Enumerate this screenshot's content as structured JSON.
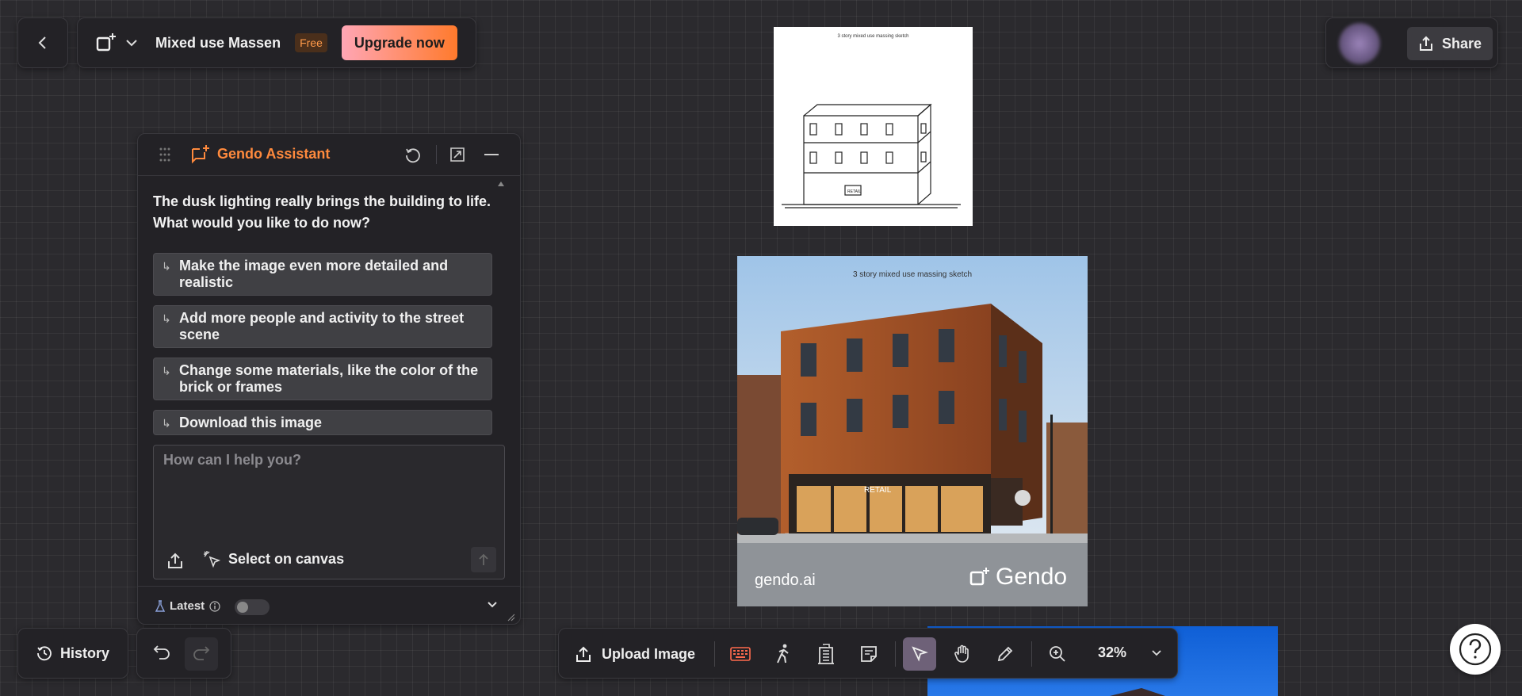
{
  "header": {
    "project_title": "Mixed use Massen",
    "plan_badge": "Free",
    "upgrade_label": "Upgrade now",
    "share_label": "Share"
  },
  "assistant": {
    "title": "Gendo Assistant",
    "message": "The dusk lighting really brings the building to life. What would you like to do now?",
    "suggestions": [
      "Make the image even more detailed and realistic",
      "Add more people and activity to the street scene",
      "Change some materials, like the color of the brick or frames",
      "Download this image"
    ],
    "input_placeholder": "How can I help you?",
    "select_on_canvas_label": "Select on canvas",
    "latest_label": "Latest",
    "latest_toggle_on": false
  },
  "canvas": {
    "sketch_caption": "3 story mixed use massing sketch",
    "render_caption": "3 story mixed use massing sketch",
    "render_sign": "RETAIL",
    "sketch_sign": "RETAIL",
    "watermark_left": "gendo.ai",
    "watermark_brand": "Gendo"
  },
  "bottom": {
    "history_label": "History",
    "upload_image_label": "Upload Image",
    "zoom_level": "32%"
  },
  "colors": {
    "accent": "#ff8a3d",
    "upgrade_gradient_start": "#ffa6b5",
    "upgrade_gradient_end": "#ff7a2c",
    "active_tool": "#6e6178"
  }
}
